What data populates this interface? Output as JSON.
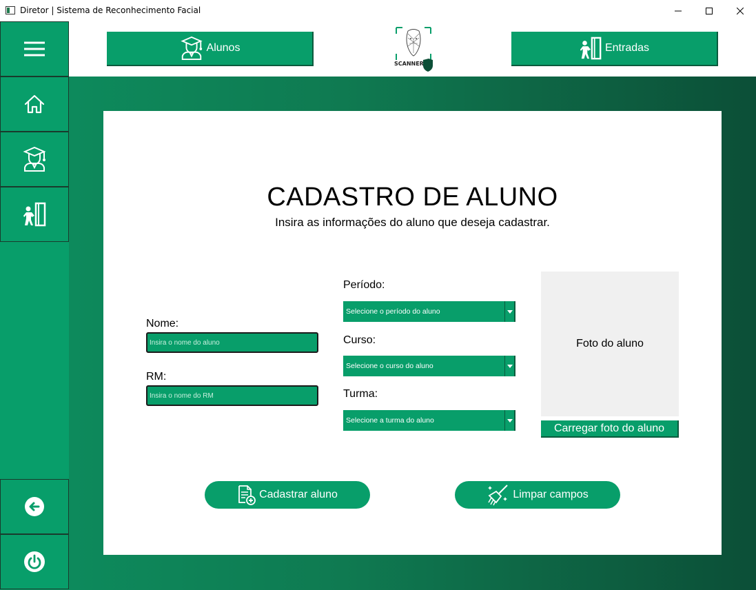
{
  "window": {
    "title": "Diretor | Sistema de Reconhecimento Facial"
  },
  "header": {
    "alunos_label": "Alunos",
    "entradas_label": "Entradas",
    "logo_text": "SCANNER"
  },
  "sidebar": {
    "items": [
      {
        "name": "menu",
        "icon": "hamburger-icon"
      },
      {
        "name": "home",
        "icon": "home-icon"
      },
      {
        "name": "alunos",
        "icon": "student-icon"
      },
      {
        "name": "entradas",
        "icon": "entry-door-icon"
      },
      {
        "name": "back",
        "icon": "arrow-left-icon"
      },
      {
        "name": "power",
        "icon": "power-icon"
      }
    ]
  },
  "form": {
    "title": "CADASTRO DE ALUNO",
    "subtitle": "Insira as informações do aluno que deseja cadastrar.",
    "nome_label": "Nome:",
    "nome_placeholder": "Insira o nome do aluno",
    "rm_label": "RM:",
    "rm_placeholder": "Insira o nome do RM",
    "periodo_label": "Período:",
    "periodo_value": "Selecione o período do aluno",
    "curso_label": "Curso:",
    "curso_value": "Selecione o curso do aluno",
    "turma_label": "Turma:",
    "turma_value": "Selecione a turma do aluno",
    "photo_placeholder": "Foto do aluno",
    "photo_button": "Carregar foto do aluno",
    "submit_button": "Cadastrar aluno",
    "clear_button": "Limpar campos"
  },
  "colors": {
    "accent": "#089e6a",
    "dark_accent": "#0c4f37"
  }
}
